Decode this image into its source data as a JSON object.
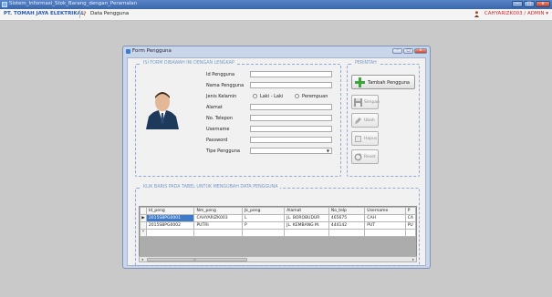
{
  "app": {
    "title": "Sistem_Informasi_Stok_Barang_dengan_Peramalan",
    "company": "PT. TOMAH JAYA ELEKTRIKAL",
    "breadcrumb": "Data Pengguna",
    "user": "CAHYARIZK003 / ADMIN",
    "user_arrow": "▾"
  },
  "form": {
    "title": "Form Pengguna",
    "input_group_label": "ISI FORM DIBAWAH INI DENGAN LENGKAP",
    "command_group_label": "PERINTAH",
    "table_group_label": "KLIK BARIS PADA TABEL UNTUK MENGUBAH DATA PENGGUNA",
    "fields": {
      "id_label": "Id Pengguna",
      "name_label": "Nama Pengguna",
      "gender_label": "Jenis Kelamin",
      "gender_male": "Laki - Laki",
      "gender_female": "Perempuan",
      "address_label": "Alamat",
      "phone_label": "No. Telepon",
      "username_label": "Username",
      "password_label": "Password",
      "type_label": "Tipe Pengguna"
    },
    "buttons": {
      "add": "Tambah Pengguna",
      "save": "Simpan",
      "edit": "Ubah",
      "delete": "Hapus",
      "reset": "Reset"
    },
    "window_buttons": {
      "minimize": "–",
      "maximize": "□",
      "close": "x"
    }
  },
  "table": {
    "columns": [
      "Id_peng",
      "Nm_peng",
      "Jk_peng",
      "Alamat",
      "No_telp",
      "Username",
      "P"
    ],
    "rows": [
      [
        "2015SBPG0001",
        "CAHYARIZK003",
        "L",
        "JL. BOROBUDUR",
        "465675",
        "CAH",
        "CA"
      ],
      [
        "2015SBPG0002",
        "PUTRI",
        "P",
        "JL. KEMBANG M.",
        "444142",
        "PUT",
        "PU"
      ]
    ],
    "current_marker": "▶",
    "new_marker": "*",
    "scroll_left": "◂",
    "scroll_right": "▸",
    "scroll_grip": "III"
  },
  "colors": {
    "accent": "#3e7ac9",
    "group_border": "#8eaad6",
    "user_text": "#cc2a2a"
  }
}
